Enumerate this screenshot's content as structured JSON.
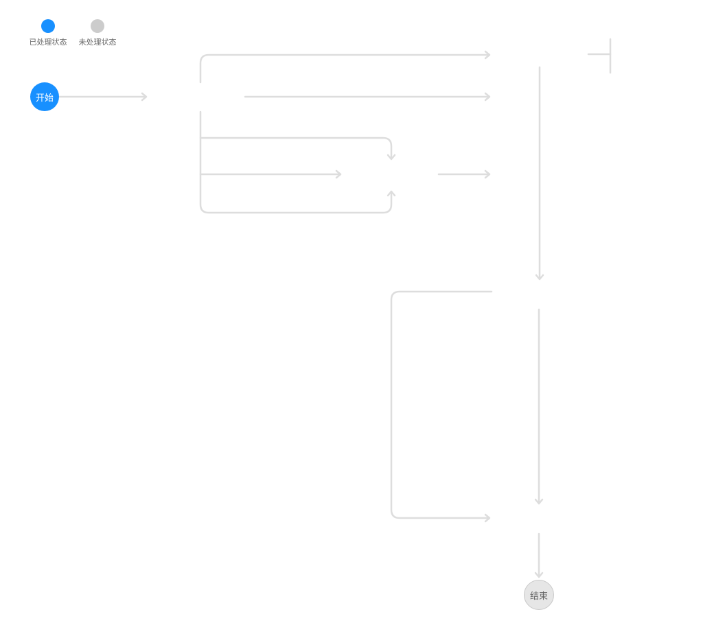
{
  "legend": {
    "processed": {
      "label": "已处理状态",
      "color": "#1890ff"
    },
    "unprocessed": {
      "label": "未处理状态",
      "color": "#cccccc"
    }
  },
  "nodes": {
    "start": {
      "label": "开始",
      "color": "#1890ff"
    },
    "end": {
      "label": "结束",
      "color": "#e6e6e6"
    }
  },
  "connector_color": "#dddddd"
}
